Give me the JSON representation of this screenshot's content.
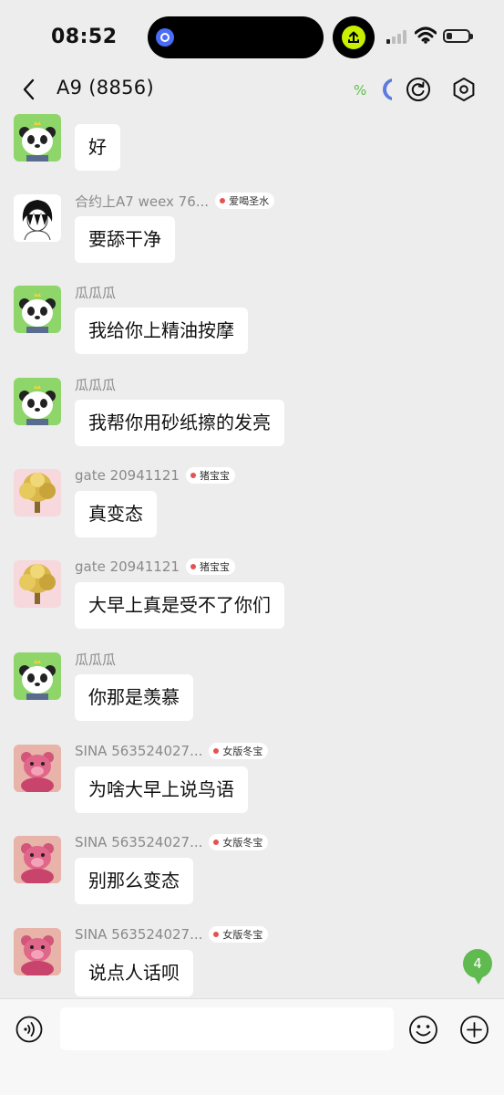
{
  "status_bar": {
    "time": "08:52"
  },
  "header": {
    "title": "A9 (8856)",
    "percent_text": "%"
  },
  "messages": [
    {
      "sender": "",
      "badge": "",
      "text": "好"
    },
    {
      "sender": "合约上A7 weex 76...",
      "badge": "爱喝圣水",
      "text": "要舔干净"
    },
    {
      "sender": "瓜瓜瓜",
      "badge": "",
      "text": "我给你上精油按摩"
    },
    {
      "sender": "瓜瓜瓜",
      "badge": "",
      "text": "我帮你用砂纸擦的发亮"
    },
    {
      "sender": "gate 20941121",
      "badge": "猪宝宝",
      "text": "真变态"
    },
    {
      "sender": "gate 20941121",
      "badge": "猪宝宝",
      "text": "大早上真是受不了你们"
    },
    {
      "sender": "瓜瓜瓜",
      "badge": "",
      "text": "你那是羡慕"
    },
    {
      "sender": "SINA  563524027...",
      "badge": "女版冬宝",
      "text": "为啥大早上说鸟语"
    },
    {
      "sender": "SINA  563524027...",
      "badge": "女版冬宝",
      "text": "别那么变态"
    },
    {
      "sender": "SINA  563524027...",
      "badge": "女版冬宝",
      "text": "说点人话呗"
    }
  ],
  "unread_count": "4",
  "input": {
    "value": "",
    "placeholder": ""
  },
  "icons": {
    "back": "chevron-left-icon",
    "refresh": "refresh-circle-icon",
    "settings": "hexagon-settings-icon",
    "voice": "voice-icon",
    "emoji": "emoji-icon",
    "plus": "plus-circle-icon"
  },
  "colors": {
    "accent_green": "#5fbb4f",
    "badge_dot": "#e55252",
    "background": "#ededed"
  }
}
